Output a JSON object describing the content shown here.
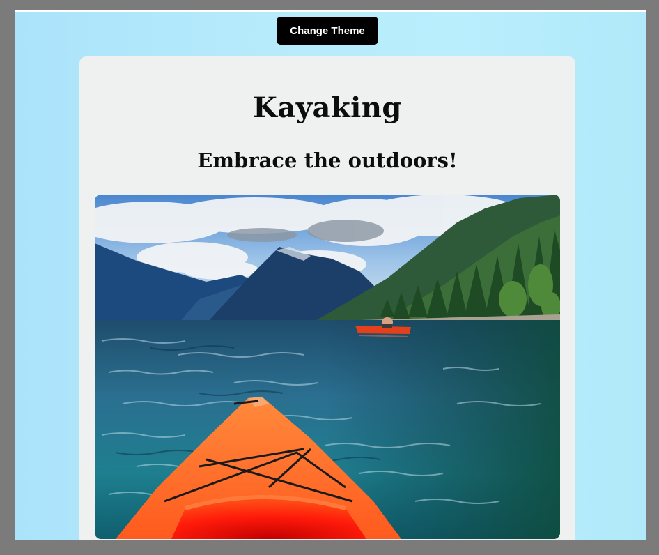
{
  "toolbar": {
    "change_theme_label": "Change Theme"
  },
  "card": {
    "title": "Kayaking",
    "subtitle": "Embrace the outdoors!"
  },
  "image": {
    "alt": "Kayaking",
    "subject": "kayak-on-lake"
  },
  "colors": {
    "page_background": "#b6ebfb",
    "card_background": "#eff1f1",
    "button_background": "#000000",
    "button_text": "#ffffff",
    "kayak": "#ff6a22"
  }
}
